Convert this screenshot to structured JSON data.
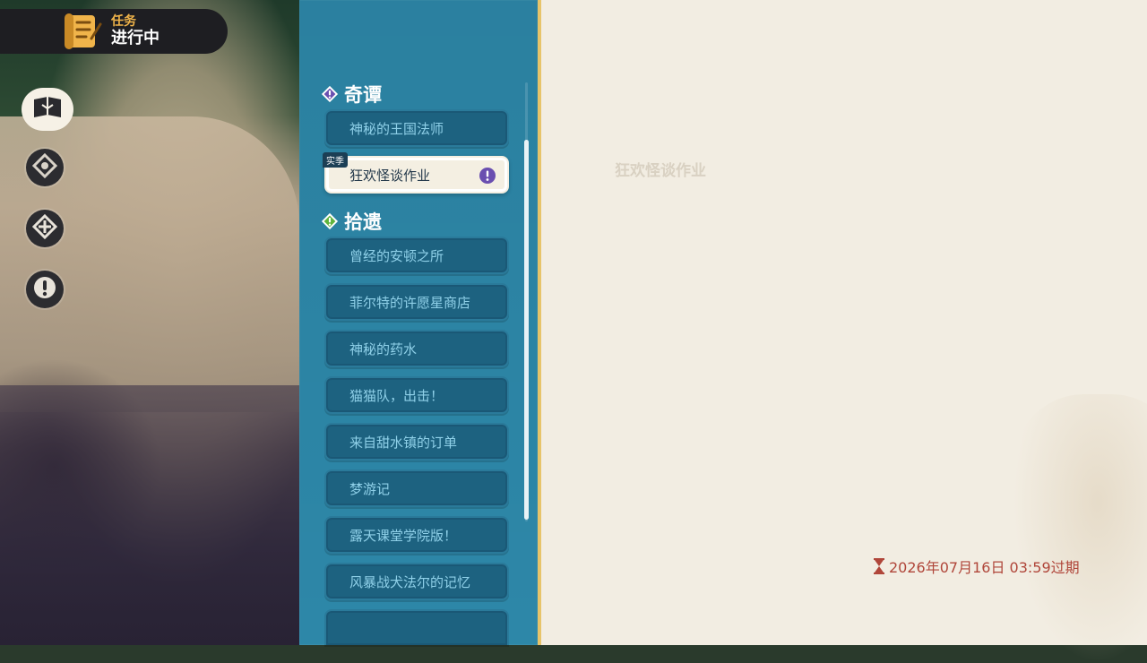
{
  "quest_header": {
    "category": "任务",
    "status": "进行中"
  },
  "rail": {
    "items": [
      {
        "name": "quest-book-icon"
      },
      {
        "name": "compass-icon"
      },
      {
        "name": "target-icon"
      },
      {
        "name": "alert-icon"
      }
    ]
  },
  "sections": [
    {
      "title": "奇谭",
      "badge_color": "#6a4fb0"
    },
    {
      "title": "拾遗",
      "badge_color": "#5fb43b"
    }
  ],
  "quests_qitan": [
    {
      "label": "神秘的王国法师"
    },
    {
      "label": "狂欢怪谈作业",
      "tag": "实季",
      "active": true
    }
  ],
  "quests_shiyi": [
    {
      "label": "曾经的安顿之所"
    },
    {
      "label": "菲尔特的许愿星商店"
    },
    {
      "label": "神秘的药水"
    },
    {
      "label": "猫猫队，出击！"
    },
    {
      "label": "来自甜水镇的订单"
    },
    {
      "label": "梦游记"
    },
    {
      "label": "露天课堂学院版！"
    },
    {
      "label": "风暴战犬法尔的记忆"
    }
  ],
  "detail": {
    "title": "狂欢怪谈作业",
    "expiry": "2026年07月16日 03:59过期"
  },
  "colors": {
    "accent": "#e7c46a",
    "list_bg": "#2d87a8",
    "item_bg": "#1d6280",
    "detail_bg": "#f2ede2",
    "expiry_red": "#b0463a"
  }
}
